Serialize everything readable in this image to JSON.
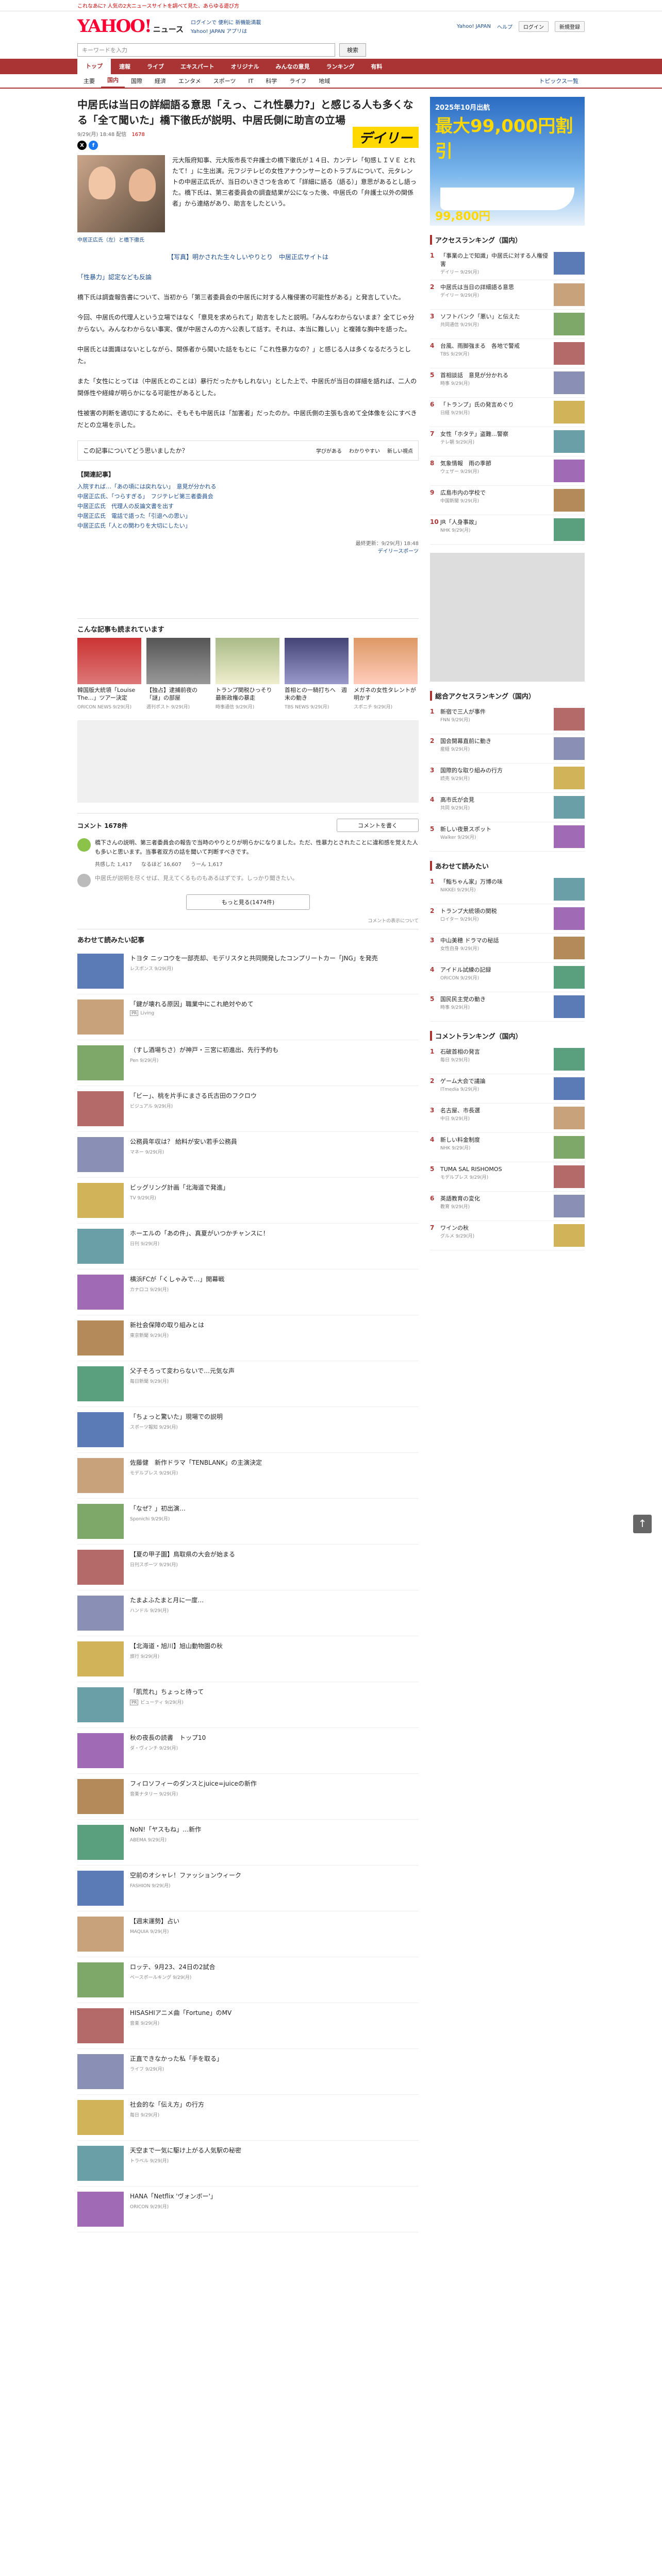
{
  "topline": {
    "text": "これなあに? 人気の2大ニュースサイトを調べて見た、あらゆる遊び方"
  },
  "header": {
    "logo": "YAHOO!",
    "logo_sub": "ニュース",
    "links": [
      "ログインで 便利に 新機能満載",
      "Yahoo! JAPAN アプリは"
    ],
    "right": [
      "Yahoo! JAPAN",
      "ヘルプ",
      "ログイン",
      "新規登録"
    ]
  },
  "search": {
    "placeholder": "キーワードを入力",
    "button": "検索"
  },
  "gnav": [
    "トップ",
    "速報",
    "ライブ",
    "エキスパート",
    "オリジナル",
    "みんなの意見",
    "ランキング",
    "有料"
  ],
  "subnav": [
    "主要",
    "国内",
    "国際",
    "経済",
    "エンタメ",
    "スポーツ",
    "IT",
    "科学",
    "ライフ",
    "地域"
  ],
  "subnav_ext": "トピックス一覧",
  "article": {
    "title": "中居氏は当日の詳細語る意思「えっ、これ性暴力?」と感じる人も多くなる「全て聞いた」橋下徹氏が説明、中居氏側に助言の立場",
    "meta": "9/29(月) 18:48 配信",
    "comments_count": "1678",
    "publisher": "デイリー",
    "lead": "元大阪府知事、元大阪市長で弁護士の橋下徹氏が１４日、カンテレ「旬感ＬＩＶＥ とれたて！」に生出演。元フジテレビの女性アナウンサーとのトラブルについて、元タレントの中居正広氏が、当日のいきさつを含めて「詳細に語る（語る）」意思があるとし語った。橋下氏は、第三者委員会の調査結果が公になった後、中居氏の「弁護士以外の関係者」から連絡があり、助言をしたという。",
    "caption": "中居正広氏（左）と橋下徹氏",
    "paras": [
      "【写真】明かされた生々しいやりとり　中居正広サイトは",
      "「性暴力」認定なども反論",
      "橋下氏は調査報告書について、当初から「第三者委員会の中居氏に対する人権侵害の可能性がある」と発言していた。",
      "今回、中居氏の代理人という立場ではなく「意見を求められて」助言をしたと説明。「みんなわからないまま？全てじゃ分からない。みんなわからない事実、僕が中居さんの方へ公表して話す。それは、本当に難しい」と複雑な胸中を語った。",
      "中居氏とは面識はないとしながら、関係者から聞いた話をもとに「これ性暴力なの？」と感じる人は多くなるだろうとした。",
      "また「女性にとっては（中居氏とのことは）暴行だったかもしれない」とした上で、中居氏が当日の詳細を語れば、二人の関係性や経緯が明らかになる可能性があるとした。",
      "性被害の判断を適切にするために、そもそも中居氏は「加害者」だったのか。中居氏側の主張も含めて全体像を公にすべきだとの立場を示した。"
    ],
    "related_title": "【関連記事】",
    "related": [
      "入院すれば…「あの頃には戻れない」　意見が分かれる",
      "中居正広氏、「つらすぎる」　フジテレビ第三者委員会",
      "中居正広氏　代理人の反論文書を出す",
      "中居正広氏　電話で語った「引退への思い」",
      "中居正広氏「人との関わりを大切にしたい」"
    ],
    "source_date": "最終更新：9/29(月) 18:48",
    "source": "デイリースポーツ"
  },
  "footer_bar": {
    "label": "この記事についてどう思いましたか？",
    "reactions": [
      "学びがある",
      "わかりやすい",
      "新しい視点"
    ]
  },
  "pickup": {
    "title": "こんな記事も読まれています",
    "items": [
      {
        "t": "韓国版大統領「Louise The…」ツアー決定",
        "m": "ORICON NEWS 9/29(月)"
      },
      {
        "t": "【独占】逮捕前夜の「謎」の部屋",
        "m": "週刊ポスト 9/29(月)"
      },
      {
        "t": "トランプ関税ひっそり　最新政権の暴走",
        "m": "時事通信 9/29(月)"
      },
      {
        "t": "首相との一騎打ちへ　週末の動き",
        "m": "TBS NEWS 9/29(月)"
      },
      {
        "t": "メガネの女性タレントが明かす",
        "m": "スポニチ 9/29(月)"
      }
    ]
  },
  "comments": {
    "title": "コメント",
    "count": "1678件",
    "write": "コメントを書く",
    "items": [
      {
        "text": "橋下さんの説明、第三者委員会の報告で当時のやりとりが明らかになりました。ただ、性暴力とされたことに違和感を覚えた人も多いと思います。当事者双方の話を聞いて判断すべきです。",
        "r": [
          "共感した",
          "なるほど",
          "うーん"
        ],
        "nums": [
          "1,417",
          "16,607",
          "1,617"
        ]
      },
      {
        "text": "中居氏が説明を尽くせば、見えてくるものもあるはずです。しっかり聞きたい。"
      }
    ],
    "more": "もっと見る(1474件)",
    "note": "コメントの表示について"
  },
  "feed": {
    "title": "あわせて読みたい記事",
    "items": [
      {
        "t": "トヨタ ニッコウを一部売却、モデリスタと共同開発したコンプリートカー「JNG」を発売",
        "m": "レスポンス 9/29(月)"
      },
      {
        "t": "「鍵が壊れる原因」職業中にこれ絶対やめて",
        "m": "Living",
        "ad": "PR"
      },
      {
        "t": "（すし酒場ちさ）が神戸・三宮に初進出、先行予約も",
        "m": "Pen 9/29(月)"
      },
      {
        "t": "「ビー」、桃を片手にまさる氏古田のフクロウ",
        "m": "ビジュアル 9/29(月)"
      },
      {
        "t": "公務員年収は？ 給料が安い若手公務員",
        "m": "マネー 9/29(月)"
      },
      {
        "t": "ビッグリング計画「北海道で発進」",
        "m": "TV 9/29(月)"
      },
      {
        "t": "ホーエルの「あの件」、真夏がいつかチャンスに！",
        "m": "日刊 9/29(月)"
      },
      {
        "t": "横浜FCが「くしゃみで…」開幕戦",
        "m": "カナロコ 9/29(月)"
      },
      {
        "t": "新社会保障の取り組みとは",
        "m": "東京新聞 9/29(月)"
      },
      {
        "t": "父子そろって変わらないで…元気な声",
        "m": "毎日新聞 9/29(月)"
      },
      {
        "t": "「ちょっと驚いた」現場での説明",
        "m": "スポーツ報知 9/29(月)"
      },
      {
        "t": "佐藤健　新作ドラマ「TENBLANK」の主演決定",
        "m": "モデルプレス 9/29(月)"
      },
      {
        "t": "「なぜ？」初出演…",
        "m": "Sponichi 9/29(月)"
      },
      {
        "t": "【夏の甲子園】鳥取県の大会が始まる",
        "m": "日刊スポーツ 9/29(月)"
      },
      {
        "t": "たまよふたまと月に一度…",
        "m": "ハンドル 9/29(月)"
      },
      {
        "t": "【北海道・旭川】旭山動物園の秋",
        "m": "旅行 9/29(月)"
      },
      {
        "t": "「肌荒れ」ちょっと待って",
        "m": "ビューティ 9/29(月)",
        "ad": "PR"
      },
      {
        "t": "秋の夜長の読書　トップ10",
        "m": "ダ・ヴィンチ 9/29(月)"
      },
      {
        "t": "フィロソフィーのダンスとjuice=juiceの新作",
        "m": "音楽ナタリー 9/29(月)"
      },
      {
        "t": "NoN!「ヤスもね」…新作",
        "m": "ABEMA 9/29(月)"
      },
      {
        "t": "空前のオシャレ！ファッションウィーク",
        "m": "FASHION 9/29(月)"
      },
      {
        "t": "【週末運勢】占い",
        "m": "MAQUIA 9/29(月)"
      },
      {
        "t": "ロッテ、9月23、24日の2試合",
        "m": "ベースボールキング 9/29(月)"
      },
      {
        "t": "HISASHIアニメ曲「Fortune」のMV",
        "m": "音楽 9/29(月)"
      },
      {
        "t": "正直できなかった私「手を取る」",
        "m": "ライフ 9/29(月)"
      },
      {
        "t": "社会的な「伝え方」の行方",
        "m": "毎日 9/29(月)"
      },
      {
        "t": "天空まで一気に駆け上がる人気駅の秘密",
        "m": "トラベル 9/29(月)"
      },
      {
        "t": "HANA「Netflix 'ヴォンボー'」",
        "m": "ORICON 9/29(月)"
      }
    ]
  },
  "side": {
    "ad": {
      "head": "2025年10月出航",
      "big": "最大99,000円割引",
      "price": "99,800円"
    },
    "rank1": {
      "title": "アクセスランキング（国内）",
      "items": [
        {
          "t": "「事業の上で知識」中居氏に対する人権侵害",
          "m": "デイリー 9/29(月)"
        },
        {
          "t": "中居氏は当日の詳細語る意思",
          "m": "デイリー 9/29(月)"
        },
        {
          "t": "ソフトバンク「悪い」と伝えた",
          "m": "共同通信 9/29(月)"
        },
        {
          "t": "台風、雨脚強まる　各地で警戒",
          "m": "TBS 9/29(月)"
        },
        {
          "t": "首相談話　意見が分かれる",
          "m": "時事 9/29(月)"
        },
        {
          "t": "「トランプ」氏の発言めぐり",
          "m": "日経 9/29(月)"
        },
        {
          "t": "女性「ホタテ」盗難…警察",
          "m": "テレ朝 9/29(月)"
        },
        {
          "t": "気象情報　雨の季節",
          "m": "ウェザー 9/29(月)"
        },
        {
          "t": "広島市内の学校で",
          "m": "中国新聞 9/29(月)"
        },
        {
          "t": "JR「人身事故」",
          "m": "NHK 9/29(月)"
        }
      ]
    },
    "rank2": {
      "title": "総合アクセスランキング（国内）",
      "items": [
        {
          "t": "新宿で三人が事件",
          "m": "FNN 9/29(月)"
        },
        {
          "t": "国会開幕直前に動き",
          "m": "産経 9/29(月)"
        },
        {
          "t": "国際的な取り組みの行方",
          "m": "読売 9/29(月)"
        },
        {
          "t": "高市氏が会見",
          "m": "共同 9/29(月)"
        },
        {
          "t": "新しい夜景スポット",
          "m": "Walker 9/29(月)"
        }
      ]
    },
    "rank3": {
      "title": "あわせて読みたい",
      "items": [
        {
          "t": "「鮨ちゃん家」万博の味",
          "m": "NIKKEI 9/29(月)"
        },
        {
          "t": "トランプ大統領の関税",
          "m": "ロイター 9/29(月)"
        },
        {
          "t": "中山美穂 ドラマの秘話",
          "m": "女性自身 9/29(月)"
        },
        {
          "t": "アイドル試練の記録",
          "m": "ORICON 9/29(月)"
        },
        {
          "t": "国民民主党の動き",
          "m": "時事 9/29(月)"
        }
      ]
    },
    "rank4": {
      "title": "コメントランキング（国内）",
      "items": [
        {
          "t": "石破首相の発言",
          "m": "毎日 9/29(月)"
        },
        {
          "t": "ゲーム大会で議論",
          "m": "ITmedia 9/29(月)"
        },
        {
          "t": "名古屋、市長選",
          "m": "中日 9/29(月)"
        },
        {
          "t": "新しい料金制度",
          "m": "NHK 9/29(月)"
        },
        {
          "t": "TUMA SAL RISHOMOS",
          "m": "モデルプレス 9/29(月)"
        },
        {
          "t": "英語教育の変化",
          "m": "教育 9/29(月)"
        },
        {
          "t": "ワインの秋",
          "m": "グルメ 9/29(月)"
        }
      ]
    }
  },
  "pagetop": "↑"
}
